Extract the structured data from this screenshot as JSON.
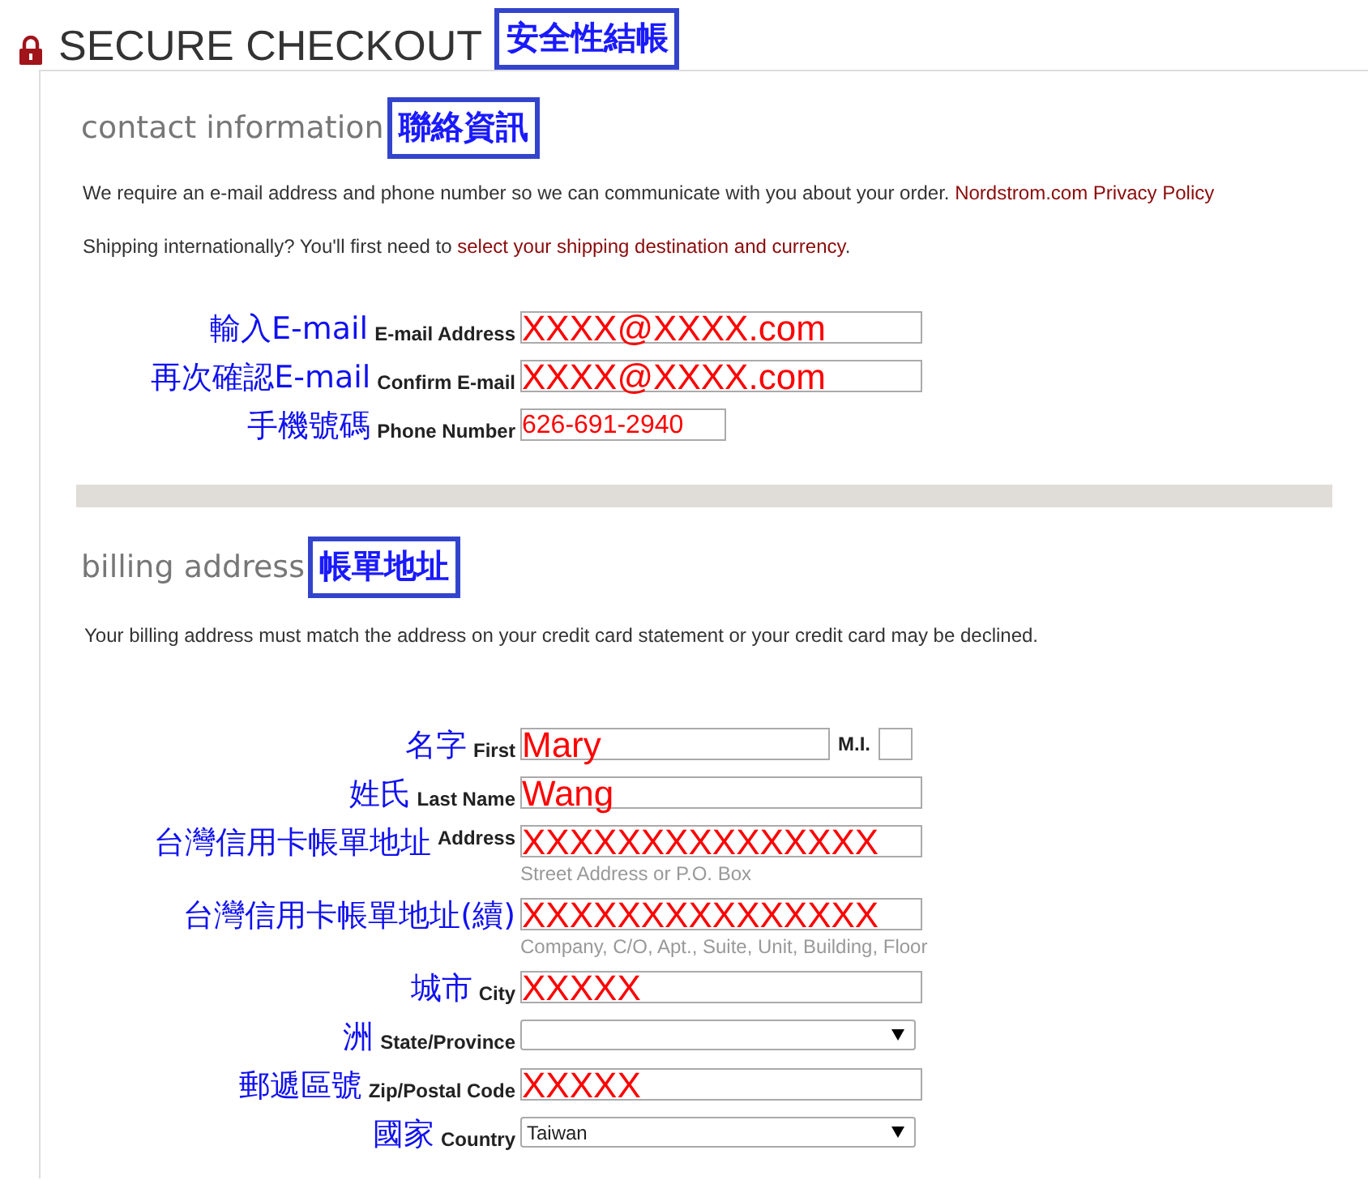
{
  "header": {
    "title": "SECURE CHECKOUT",
    "annotation": "安全性結帳"
  },
  "sections": [
    {
      "heading": "contact information",
      "annotation": "聯絡資訊",
      "paragraphs": [
        [
          {
            "text": "We require an e-mail address and phone number so we can communicate with you about your order. "
          },
          {
            "text": "Nordstrom.com Privacy Policy",
            "kind": "link"
          }
        ],
        [
          {
            "text": "Shipping internationally? You'll first need to "
          },
          {
            "text": "select your shipping destination and currency",
            "kind": "link"
          },
          {
            "text": "."
          }
        ]
      ],
      "fields": [
        {
          "annotation": "輸入E-mail",
          "label": "E-mail Address",
          "kind": "text",
          "value": "XXXX@XXXX.com"
        },
        {
          "annotation": "再次確認E-mail",
          "label": "Confirm E-mail",
          "kind": "text",
          "value": "XXXX@XXXX.com"
        },
        {
          "annotation": "手機號碼",
          "label": "Phone Number",
          "kind": "phone",
          "value": "626-691-2940"
        }
      ]
    },
    {
      "heading": "billing address",
      "annotation": "帳單地址",
      "paragraphs": [
        [
          {
            "text": "Your billing address must match the address on your credit card statement or your credit card may be declined."
          }
        ]
      ],
      "fields": [
        {
          "annotation": "名字",
          "label": "First",
          "kind": "text",
          "value": "Mary",
          "extra_label": "M.I."
        },
        {
          "annotation": "姓氏",
          "label": "Last Name",
          "kind": "text",
          "value": "Wang"
        },
        {
          "annotation": "台灣信用卡帳單地址",
          "label": "Address",
          "kind": "text",
          "value": "XXXXXXXXXXXXXXX",
          "hint": "Street Address or P.O. Box"
        },
        {
          "annotation": "台灣信用卡帳單地址(續)",
          "kind": "text",
          "value": "XXXXXXXXXXXXXXX",
          "hint": "Company, C/O, Apt., Suite, Unit, Building, Floor"
        },
        {
          "annotation": "城市",
          "label": "City",
          "kind": "text",
          "value": "XXXXX"
        },
        {
          "annotation": "洲",
          "label": "State/Province",
          "kind": "select"
        },
        {
          "annotation": "郵遞區號",
          "label": "Zip/Postal Code",
          "kind": "text",
          "value": "XXXXX"
        },
        {
          "annotation": "國家",
          "label": "Country",
          "kind": "select",
          "value": "Taiwan"
        }
      ]
    }
  ]
}
